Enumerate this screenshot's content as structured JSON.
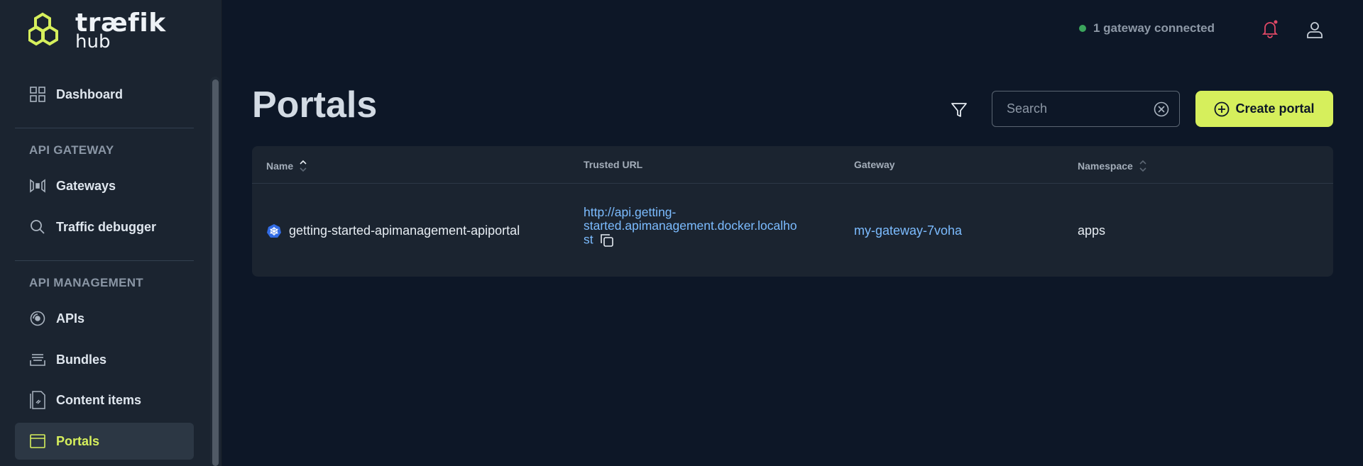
{
  "brand": {
    "line1": "træfik",
    "line2": "hub",
    "accent": "#d6ef5c"
  },
  "sidebar": {
    "dashboard": "Dashboard",
    "section_api_gateway": "API GATEWAY",
    "gateways": "Gateways",
    "traffic_debugger": "Traffic debugger",
    "section_api_management": "API MANAGEMENT",
    "apis": "APIs",
    "bundles": "Bundles",
    "content_items": "Content items",
    "portals": "Portals"
  },
  "topbar": {
    "gateway_status": "1 gateway connected"
  },
  "header": {
    "title": "Portals",
    "search_placeholder": "Search",
    "create_label": "Create portal"
  },
  "table": {
    "columns": [
      "Name",
      "Trusted URL",
      "Gateway",
      "Namespace"
    ],
    "rows": [
      {
        "name": "getting-started-apimanagement-apiportal",
        "url_line1": "http://api.getting-",
        "url_line2": "started.apimanagement.docker.localho",
        "url_line3": "st",
        "gateway": "my-gateway-7voha",
        "namespace": "apps"
      }
    ]
  }
}
